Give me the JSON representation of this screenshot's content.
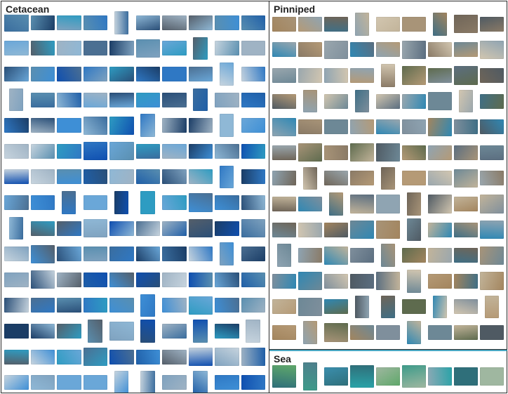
{
  "clusters": [
    {
      "id": "cetacean",
      "label": "Cetacean",
      "palette": [
        "#1f5fa8",
        "#2f78c4",
        "#3e8fd6",
        "#6aa7d8",
        "#8fb8d6",
        "#2a4f78",
        "#1b3d66",
        "#4b6f92",
        "#9fb3c4",
        "#5a8fb0",
        "#7fa2bf",
        "#3a6d9e",
        "#c7d4de",
        "#0f4fb0",
        "#2e9cc2",
        "#555f6a"
      ]
    },
    {
      "id": "pinniped",
      "label": "Pinniped",
      "palette": [
        "#8a7a66",
        "#a89478",
        "#6f6558",
        "#5b6e80",
        "#7f8f9c",
        "#c2b49a",
        "#4f5a63",
        "#9aa7ae",
        "#b59a76",
        "#3f6f86",
        "#6d8896",
        "#d2c6b0",
        "#5e6b4e",
        "#8fa4b2",
        "#2f88b4",
        "#a3855e"
      ]
    },
    {
      "id": "sea",
      "label": "Sea",
      "palette": [
        "#2aa3a8",
        "#3b8fae",
        "#5fa86a",
        "#7ab4a0",
        "#4e7f8c",
        "#8da9b5",
        "#2f6f7a",
        "#9fb7a0",
        "#3d9b8a",
        "#6f8fa0"
      ]
    }
  ]
}
